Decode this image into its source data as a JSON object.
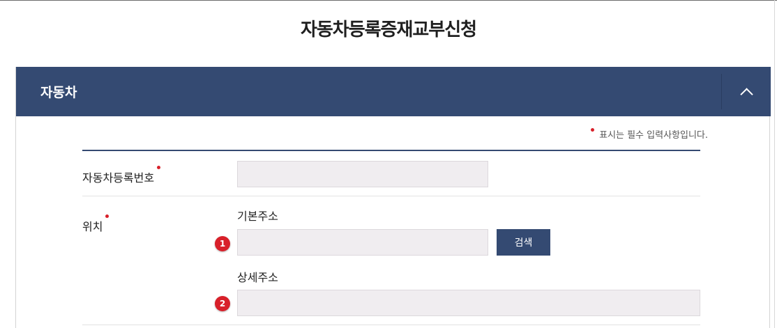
{
  "page": {
    "title": "자동차등록증재교부신청"
  },
  "panel": {
    "title": "자동차",
    "collapse_icon": "chevron-up-icon"
  },
  "form": {
    "required_note": "표시는 필수 입력사항입니다.",
    "vehicle_number": {
      "label": "자동차등록번호",
      "value": "",
      "placeholder": ""
    },
    "location": {
      "label": "위치",
      "basic_address": {
        "label": "기본주소",
        "value": "",
        "placeholder": ""
      },
      "search_button": "검색",
      "detail_address": {
        "label": "상세주소",
        "value": "",
        "placeholder": ""
      }
    }
  },
  "markers": [
    "1",
    "2"
  ],
  "colors": {
    "primary": "#344a72",
    "required": "#d8202a",
    "input_bg": "#f0edf0"
  }
}
